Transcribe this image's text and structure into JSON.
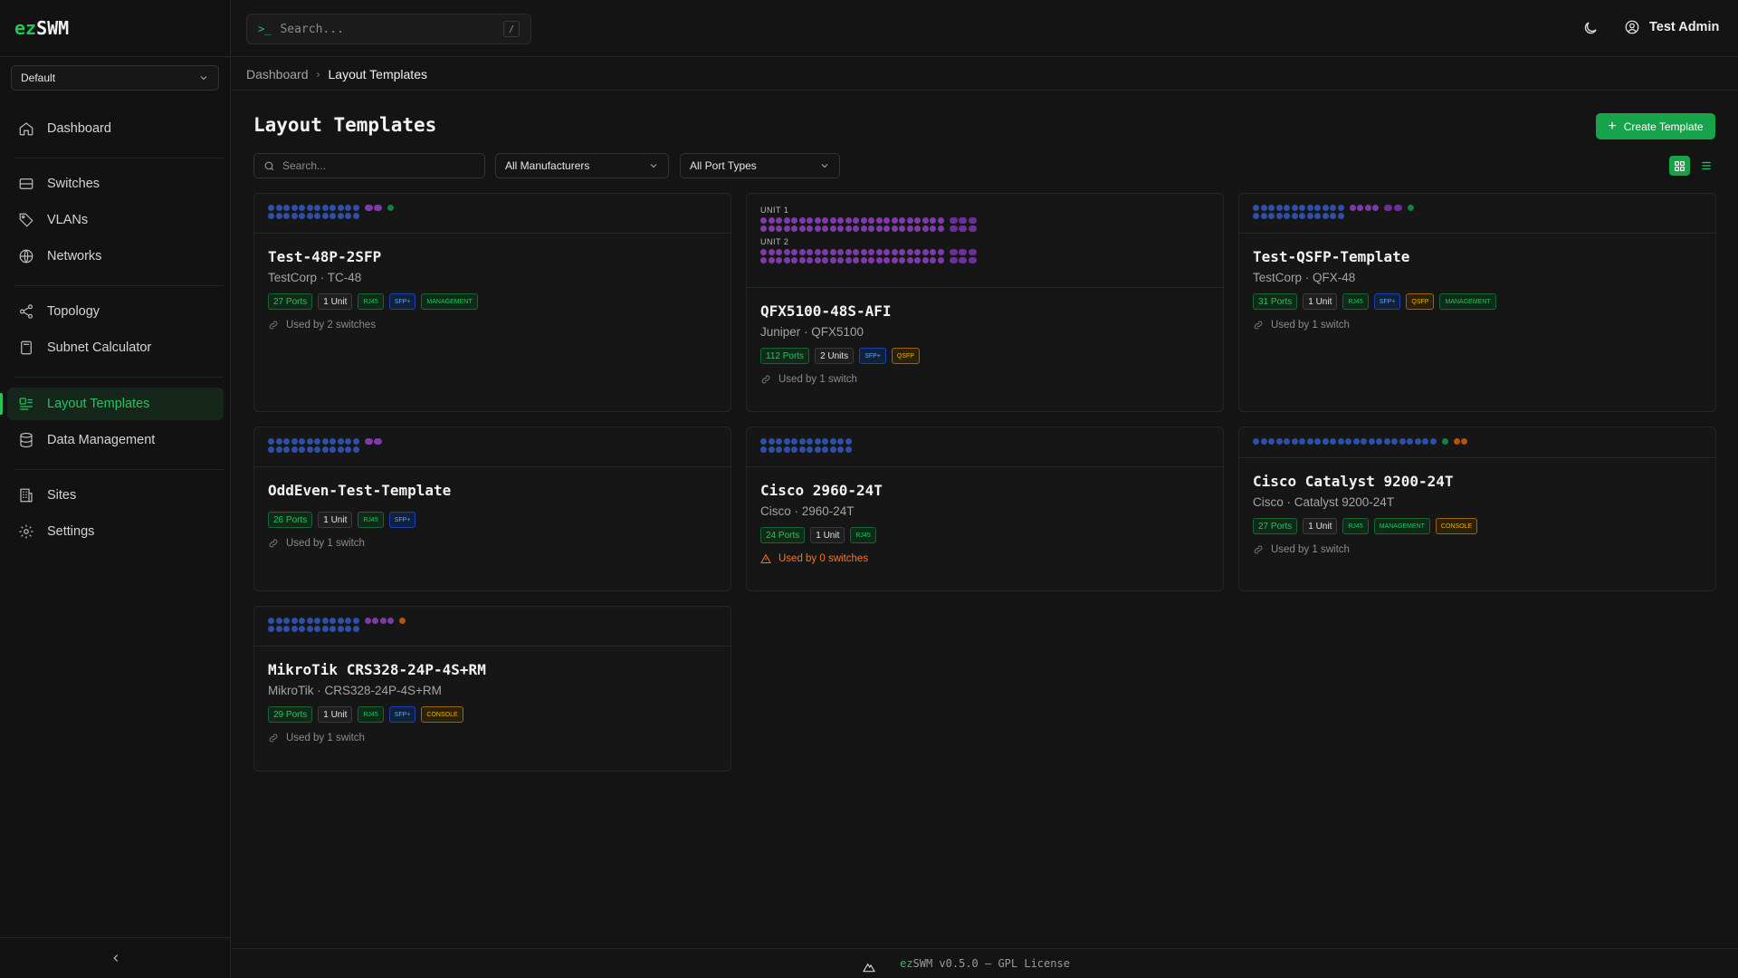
{
  "brand": {
    "prefix": "ez",
    "suffix": "SWM"
  },
  "site_selector": {
    "value": "Default"
  },
  "nav": {
    "dashboard": "Dashboard",
    "switches": "Switches",
    "vlans": "VLANs",
    "networks": "Networks",
    "topology": "Topology",
    "subnet_calculator": "Subnet Calculator",
    "layout_templates": "Layout Templates",
    "data_management": "Data Management",
    "sites": "Sites",
    "settings": "Settings"
  },
  "topbar": {
    "search_placeholder": "Search...",
    "search_prompt": ">_",
    "shortcut": "/",
    "user_name": "Test Admin"
  },
  "breadcrumb": {
    "parent": "Dashboard",
    "current": "Layout Templates"
  },
  "page": {
    "title": "Layout Templates",
    "create_label": "Create Template"
  },
  "filters": {
    "search_placeholder": "Search...",
    "manufacturer": "All Manufacturers",
    "port_type": "All Port Types"
  },
  "templates": [
    {
      "name": "Test-48P-2SFP",
      "subtitle": "TestCorp · TC-48",
      "ports": "27 Ports",
      "units": "1 Unit",
      "types": [
        "RJ45",
        "SFP+",
        "MANAGEMENT"
      ],
      "used": "Used by 2 switches"
    },
    {
      "name": "QFX5100-48S-AFI",
      "subtitle": "Juniper · QFX5100",
      "ports": "112 Ports",
      "units": "2 Units",
      "types": [
        "SFP+",
        "QSFP"
      ],
      "used": "Used by 1 switch",
      "unit_labels": [
        "UNIT 1",
        "UNIT 2"
      ]
    },
    {
      "name": "Test-QSFP-Template",
      "subtitle": "TestCorp · QFX-48",
      "ports": "31 Ports",
      "units": "1 Unit",
      "types": [
        "RJ45",
        "SFP+",
        "QSFP",
        "MANAGEMENT"
      ],
      "used": "Used by 1 switch"
    },
    {
      "name": "OddEven-Test-Template",
      "subtitle": "",
      "ports": "26 Ports",
      "units": "1 Unit",
      "types": [
        "RJ45",
        "SFP+"
      ],
      "used": "Used by 1 switch"
    },
    {
      "name": "Cisco 2960-24T",
      "subtitle": "Cisco · 2960-24T",
      "ports": "24 Ports",
      "units": "1 Unit",
      "types": [
        "RJ45"
      ],
      "used": "Used by 0 switches"
    },
    {
      "name": "Cisco Catalyst 9200-24T",
      "subtitle": "Cisco · Catalyst 9200-24T",
      "ports": "27 Ports",
      "units": "1 Unit",
      "types": [
        "RJ45",
        "MANAGEMENT",
        "CONSOLE"
      ],
      "used": "Used by 1 switch"
    },
    {
      "name": "MikroTik CRS328-24P-4S+RM",
      "subtitle": "MikroTik · CRS328-24P-4S+RM",
      "ports": "29 Ports",
      "units": "1 Unit",
      "types": [
        "RJ45",
        "SFP+",
        "CONSOLE"
      ],
      "used": "Used by 1 switch"
    }
  ],
  "footer": {
    "prefix": "ez",
    "text": "SWM v0.5.0 — GPL License"
  },
  "colors": {
    "accent": "#22c55e",
    "rj45": "#2d4fa8",
    "sfp": "#7e3aa8",
    "mgmt": "#15803d",
    "console": "#b45309",
    "warning": "#f97316"
  }
}
